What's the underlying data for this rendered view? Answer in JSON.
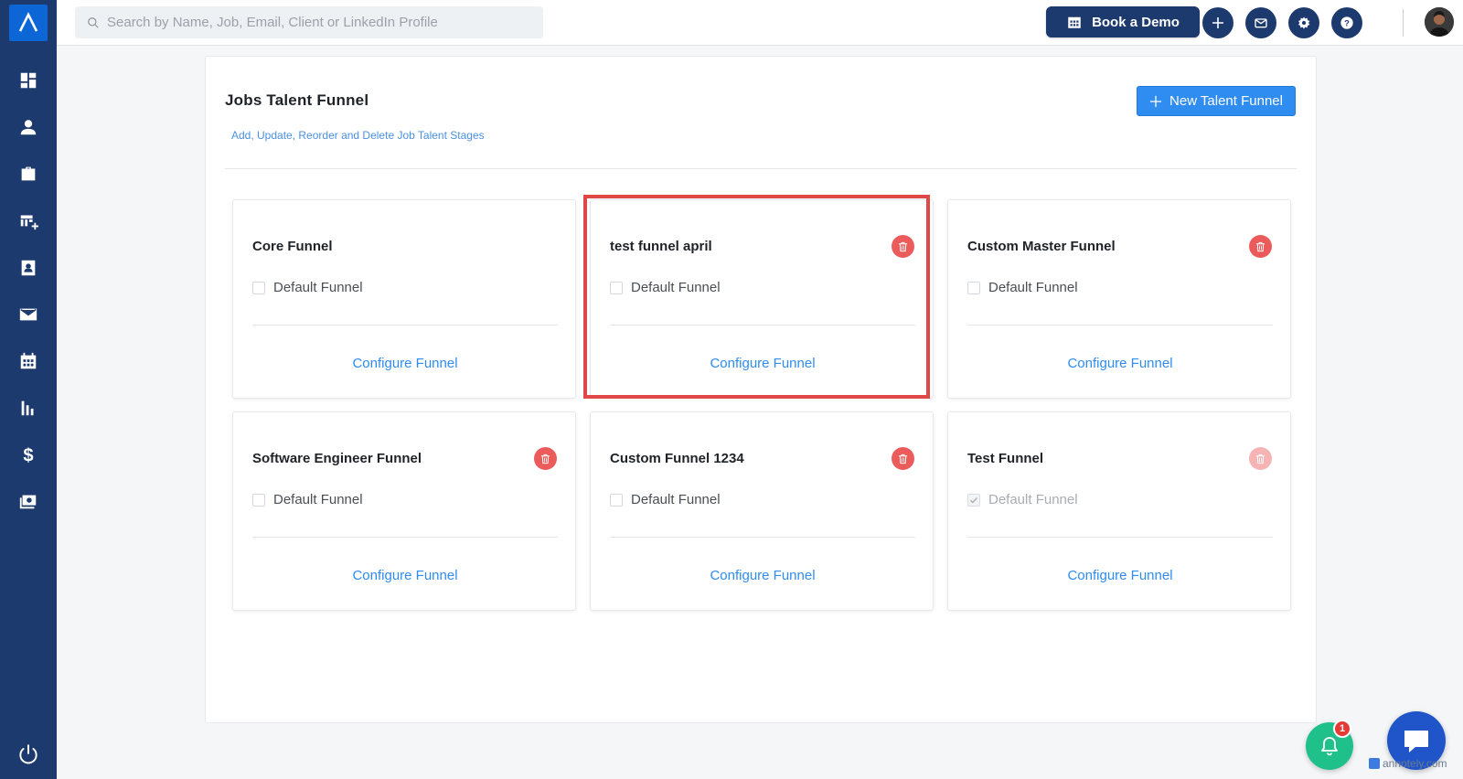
{
  "header": {
    "search_placeholder": "Search by Name, Job, Email, Client or LinkedIn Profile",
    "book_demo_label": "Book a Demo"
  },
  "page": {
    "title": "Jobs Talent Funnel",
    "subtitle": "Add, Update, Reorder and Delete Job Talent Stages",
    "new_button_label": "New Talent Funnel"
  },
  "funnels": [
    {
      "name": "Core Funnel",
      "default_label": "Default Funnel",
      "is_default": false,
      "deletable": false,
      "configure_label": "Configure Funnel"
    },
    {
      "name": "test funnel april",
      "default_label": "Default Funnel",
      "is_default": false,
      "deletable": true,
      "configure_label": "Configure Funnel"
    },
    {
      "name": "Custom Master Funnel",
      "default_label": "Default Funnel",
      "is_default": false,
      "deletable": true,
      "configure_label": "Configure Funnel"
    },
    {
      "name": "Software Engineer Funnel",
      "default_label": "Default Funnel",
      "is_default": false,
      "deletable": true,
      "configure_label": "Configure Funnel"
    },
    {
      "name": "Custom Funnel 1234",
      "default_label": "Default Funnel",
      "is_default": false,
      "deletable": true,
      "configure_label": "Configure Funnel"
    },
    {
      "name": "Test Funnel",
      "default_label": "Default Funnel",
      "is_default": true,
      "deletable": false,
      "configure_label": "Configure Funnel"
    }
  ],
  "notifications": {
    "count": "1"
  },
  "watermark": "annotely.com",
  "colors": {
    "sidebar": "#1d3a6e",
    "accent": "#2f8cf0",
    "danger": "#ec5b5b",
    "highlight": "#e04848",
    "fab_green": "#1fc089",
    "fab_blue": "#1f55c8"
  }
}
